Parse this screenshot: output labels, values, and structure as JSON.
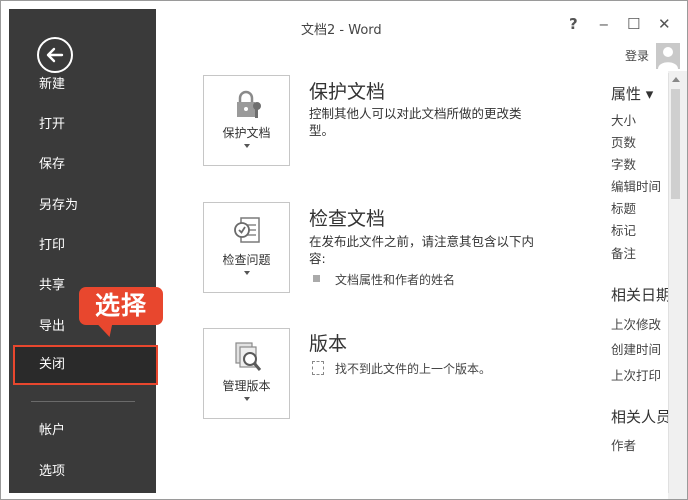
{
  "window": {
    "title": "文档2 - Word",
    "help": "?",
    "minimize": "‒",
    "maximize": "☐",
    "close": "✕"
  },
  "account": {
    "signin": "登录"
  },
  "nav": {
    "items": [
      {
        "label": "新建"
      },
      {
        "label": "打开"
      },
      {
        "label": "保存"
      },
      {
        "label": "另存为"
      },
      {
        "label": "打印"
      },
      {
        "label": "共享"
      },
      {
        "label": "导出"
      },
      {
        "label": "关闭"
      },
      {
        "label": "帐户"
      },
      {
        "label": "选项"
      }
    ],
    "active": "关闭"
  },
  "callout": {
    "text": "选择"
  },
  "sections": [
    {
      "tile_label": "保护文档",
      "title": "保护文档",
      "desc": "控制其他人可以对此文档所做的更改类型。",
      "tile_icon": "lock-key-icon"
    },
    {
      "tile_label": "检查问题",
      "title": "检查文档",
      "desc": "在发布此文件之前，请注意其包含以下内容:",
      "bullet": "文档属性和作者的姓名",
      "tile_icon": "inspect-document-icon"
    },
    {
      "tile_label": "管理版本",
      "title": "版本",
      "desc": "找不到此文件的上一个版本。",
      "tile_icon": "manage-versions-icon"
    }
  ],
  "properties": {
    "header": "属性 ▾",
    "items": [
      "大小",
      "页数",
      "字数",
      "编辑时间",
      "标题",
      "标记",
      "备注"
    ],
    "related_dates": "相关日期",
    "dates": [
      "上次修改",
      "创建时间",
      "上次打印"
    ],
    "related_people": "相关人员",
    "people": [
      "作者"
    ]
  },
  "colors": {
    "nav_bg": "#3a3a3a",
    "accent": "#e8472e"
  }
}
